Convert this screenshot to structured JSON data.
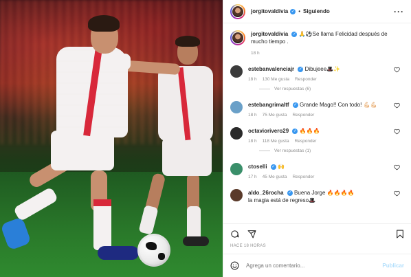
{
  "header": {
    "username": "jorgitovaldivia",
    "follow_status": "Siguiendo",
    "more_label": "···"
  },
  "caption": {
    "username": "jorgitovaldivia",
    "text": "🙏⚽️Se llama Felicidad después de mucho tiempo .",
    "time": "18 h"
  },
  "comments": [
    {
      "username": "estebanvalenciajr",
      "verified": true,
      "text": "Dibujeee🎩✨",
      "time": "18 h",
      "likes": "130 Me gusta",
      "reply": "Responder",
      "replies": "Ver respuestas (6)",
      "avatar_color": "#3b3b3b"
    },
    {
      "username": "estebangrimaltf",
      "verified": true,
      "text": "Grande Mago!! Con todo! 💪🏻💪🏻",
      "time": "18 h",
      "likes": "75 Me gusta",
      "reply": "Responder",
      "avatar_color": "#6aa0c8"
    },
    {
      "username": "octaviorivero29",
      "verified": true,
      "text": "🔥🔥🔥",
      "time": "18 h",
      "likes": "118 Me gusta",
      "reply": "Responder",
      "replies": "Ver respuestas (1)",
      "avatar_color": "#2a2a2a"
    },
    {
      "username": "ctoselli",
      "verified": true,
      "text": "🙌",
      "time": "17 h",
      "likes": "45 Me gusta",
      "reply": "Responder",
      "avatar_color": "#3a8f6a"
    },
    {
      "username": "aldo_26rocha",
      "verified": true,
      "text": "Buena Jorge 🔥🔥🔥🔥",
      "text2": "la magia está de regreso🎩",
      "avatar_color": "#5a3a2a"
    }
  ],
  "footer": {
    "posted_when": "HACE 18 HORAS",
    "add_comment_placeholder": "Agrega un comentario...",
    "publish_label": "Publicar"
  },
  "colors": {
    "link_blue": "#3897f0",
    "muted": "#8e8e8e",
    "publish_disabled": "#b2dffc"
  },
  "icons": [
    "more-horizontal-icon",
    "verified-badge-icon",
    "heart-icon",
    "comment-icon",
    "share-icon",
    "bookmark-icon",
    "emoji-icon"
  ]
}
